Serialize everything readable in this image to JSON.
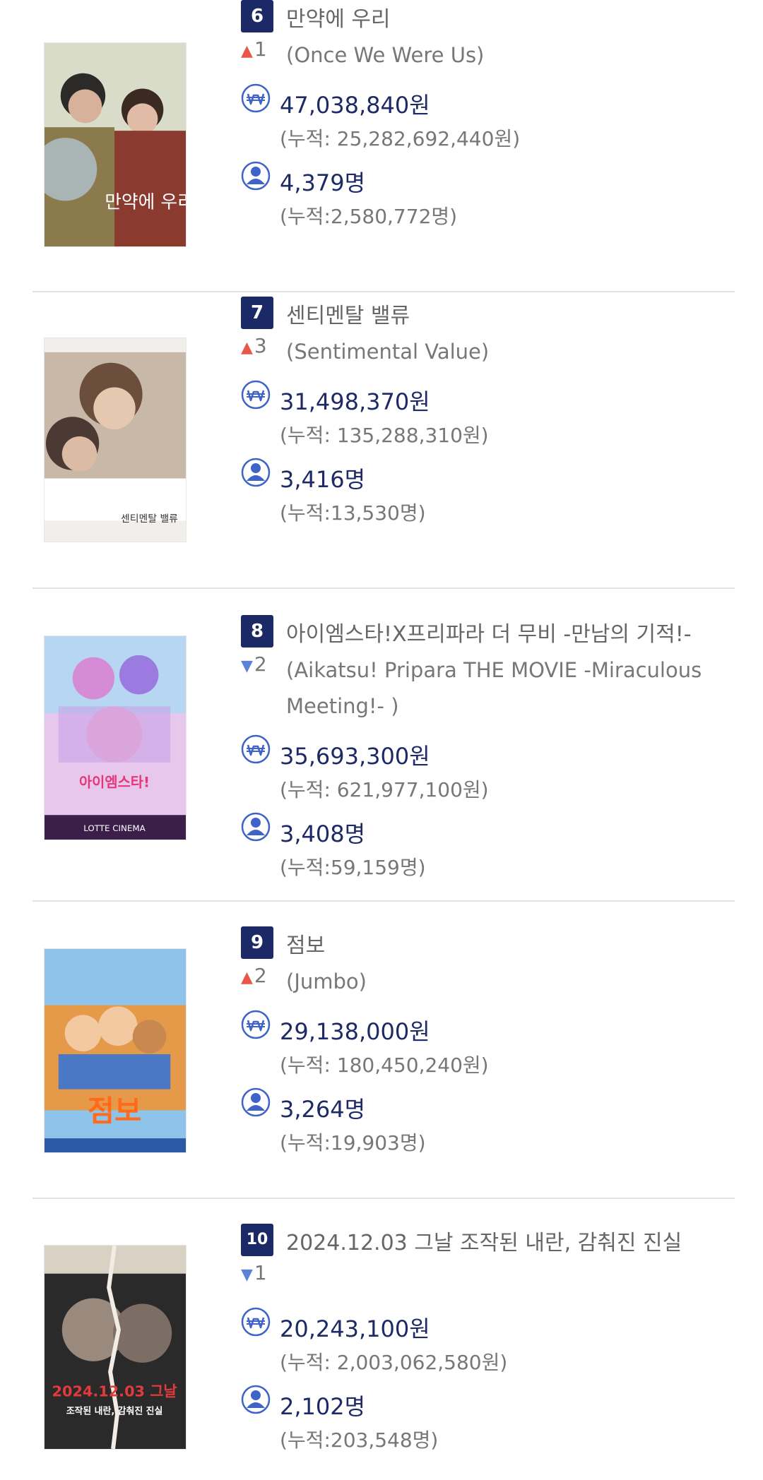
{
  "movies": [
    {
      "rank": "6",
      "title_ko": "만약에 우리",
      "change_dir": "up",
      "change": "1",
      "title_en": "(Once We Were Us)",
      "revenue": "47,038,840원",
      "revenue_total": "(누적: 25,282,692,440원)",
      "audience": "4,379명",
      "audience_total": "(누적:2,580,772명)",
      "poster_text": "만약에 우리"
    },
    {
      "rank": "7",
      "title_ko": "센티멘탈 밸류",
      "change_dir": "up",
      "change": "3",
      "title_en": "(Sentimental Value)",
      "revenue": "31,498,370원",
      "revenue_total": "(누적: 135,288,310원)",
      "audience": "3,416명",
      "audience_total": "(누적:13,530명)",
      "poster_text": "센티멘탈 밸류"
    },
    {
      "rank": "8",
      "title_ko": "아이엠스타!X프리파라 더 무비 -만남의 기적!-",
      "change_dir": "down",
      "change": "2",
      "title_en": "(Aikatsu! Pripara THE MOVIE -Miraculous Meeting!- )",
      "revenue": "35,693,300원",
      "revenue_total": "(누적: 621,977,100원)",
      "audience": "3,408명",
      "audience_total": "(누적:59,159명)",
      "poster_text": "LOTTE CINEMA"
    },
    {
      "rank": "9",
      "title_ko": "점보",
      "change_dir": "up",
      "change": "2",
      "title_en": "(Jumbo)",
      "revenue": "29,138,000원",
      "revenue_total": "(누적: 180,450,240원)",
      "audience": "3,264명",
      "audience_total": "(누적:19,903명)",
      "poster_text": "점보"
    },
    {
      "rank": "10",
      "title_ko": "2024.12.03 그날 조작된 내란, 감춰진 진실",
      "change_dir": "down",
      "change": "1",
      "title_en": "",
      "revenue": "20,243,100원",
      "revenue_total": "(누적: 2,003,062,580원)",
      "audience": "2,102명",
      "audience_total": "(누적:203,548명)",
      "poster_text": "2024.12.03 그날",
      "poster_subtext": "조작된 내란, 감춰진 진실"
    }
  ],
  "icons": {
    "revenue": "won-coin-icon",
    "audience": "person-icon",
    "up": "arrow-up-icon",
    "down": "arrow-down-icon"
  },
  "colors": {
    "rank_badge": "#1b2a66",
    "value_text": "#1e2a66",
    "icon_blue": "#3e63c9",
    "arrow_up": "#e8584a",
    "arrow_down": "#5b82d6"
  }
}
